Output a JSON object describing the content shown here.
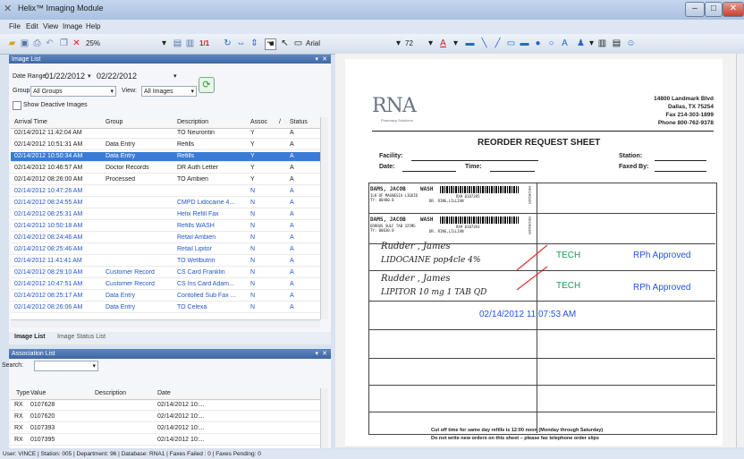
{
  "window": {
    "title": "Helix™ Imaging Module"
  },
  "menu": [
    "File",
    "Edit",
    "View",
    "Image",
    "Help"
  ],
  "toolbar": {
    "zoom": "25%",
    "pages": "1/1",
    "font": "Arial",
    "font_size": "72"
  },
  "image_list": {
    "title": "Image List",
    "date_range_label": "Date Range:",
    "date_from": "01/22/2012",
    "date_to": "02/22/2012",
    "group_label": "Group:",
    "group_value": "All Groups",
    "view_label": "View:",
    "view_value": "All Images",
    "show_deactive": "Show Deactive Images",
    "columns": [
      "Arrival Time",
      "Group",
      "Description",
      "Assoc",
      "Status"
    ],
    "rows": [
      {
        "time": "02/14/2012 11:42:04 AM",
        "group": "",
        "desc": "TO Neurontin",
        "assoc": "Y",
        "status": "A"
      },
      {
        "time": "02/14/2012 10:51:31 AM",
        "group": "Data Entry",
        "desc": "Refills",
        "assoc": "Y",
        "status": "A"
      },
      {
        "time": "02/14/2012 10:50:34 AM",
        "group": "Data Entry",
        "desc": "Refills",
        "assoc": "Y",
        "status": "A"
      },
      {
        "time": "02/14/2012 10:46:57 AM",
        "group": "Doctor Records",
        "desc": "DR Auth Letter",
        "assoc": "Y",
        "status": "A"
      },
      {
        "time": "02/14/2012 08:26:00 AM",
        "group": "Processed",
        "desc": "TO Ambien",
        "assoc": "Y",
        "status": "A"
      },
      {
        "time": "02/14/2012 10:47:26 AM",
        "group": "",
        "desc": "",
        "assoc": "N",
        "status": "A"
      },
      {
        "time": "02/14/2012 08:24:55 AM",
        "group": "",
        "desc": "CMPD Lidocaine 4...",
        "assoc": "N",
        "status": "A"
      },
      {
        "time": "02/14/2012 08:25:31 AM",
        "group": "",
        "desc": "Helix Refill Fax",
        "assoc": "N",
        "status": "A"
      },
      {
        "time": "02/14/2012 10:50:18 AM",
        "group": "",
        "desc": "Refills WASH",
        "assoc": "N",
        "status": "A"
      },
      {
        "time": "02/14/2012 08:24:46 AM",
        "group": "",
        "desc": "Retail Ambien",
        "assoc": "N",
        "status": "A"
      },
      {
        "time": "02/14/2012 08:25:46 AM",
        "group": "",
        "desc": "Retail Lipitor",
        "assoc": "N",
        "status": "A"
      },
      {
        "time": "02/14/2012 11:41:41 AM",
        "group": "",
        "desc": "TO Wellbutrin",
        "assoc": "N",
        "status": "A"
      },
      {
        "time": "02/14/2012 08:29:10 AM",
        "group": "Customer Record",
        "desc": "CS Card Franklin",
        "assoc": "N",
        "status": "A"
      },
      {
        "time": "02/14/2012 10:47:51 AM",
        "group": "Customer Record",
        "desc": "CS Ins Card Adam...",
        "assoc": "N",
        "status": "A"
      },
      {
        "time": "02/14/2012 08:25:17 AM",
        "group": "Data Entry",
        "desc": "Contolled Sub Fax ...",
        "assoc": "N",
        "status": "A"
      },
      {
        "time": "02/14/2012 08:26:06 AM",
        "group": "Data Entry",
        "desc": "TO Celexa",
        "assoc": "N",
        "status": "A"
      }
    ],
    "tabs": [
      "Image List",
      "Image Status List"
    ]
  },
  "association_list": {
    "title": "Association List",
    "search_label": "Search:",
    "columns": [
      "Type",
      "Value",
      "Description",
      "Date"
    ],
    "rows": [
      {
        "type": "RX",
        "value": "0107628",
        "desc": "",
        "date": "02/14/2012 10:..."
      },
      {
        "type": "RX",
        "value": "0107620",
        "desc": "",
        "date": "02/14/2012 10:..."
      },
      {
        "type": "RX",
        "value": "0107393",
        "desc": "",
        "date": "02/14/2012 10:..."
      },
      {
        "type": "RX",
        "value": "0107395",
        "desc": "",
        "date": "02/14/2012 10:..."
      }
    ]
  },
  "document": {
    "logo": "RNA",
    "logo_sub": "Pharmacy Solutions",
    "address": [
      "14800 Landmark Blvd",
      "Dallas, TX 75254",
      "Fax 214-303-1899",
      "Phone 800-762-9378"
    ],
    "title": "REORDER REQUEST SHEET",
    "facility_label": "Facility:",
    "date_label": "Date:",
    "time_label": "Time:",
    "station_label": "Station:",
    "faxed_label": "Faxed By:",
    "label1_name": "DAMS, JACOB",
    "label1_site": "WASH",
    "label1_drug": "ILK OF MAGNESIA LIQUID",
    "label1_rx": "RX# 0107395",
    "label1_qty": "TY: 00480.0",
    "label1_dr": "DR. RING,LILLIAN",
    "label2_name": "DAMS, JACOB",
    "label2_site": "WASH",
    "label2_drug": "ERROUS SULF TAB 325MG",
    "label2_rx": "RX# 0107393",
    "label2_qty": "TY: 00030.0",
    "label2_dr": "DR. RING,LILLIAN",
    "reorder": "REORDER",
    "hand1a": "Rudder , James",
    "hand1b": "LIDOCAINE  pop4cle  4%",
    "hand2a": "Rudder , James",
    "hand2b": "LIPITOR  10 mg  1 TAB QD",
    "tech": "TECH",
    "rph": "RPh Approved",
    "stamp": "02/14/2012 11:07:53 AM",
    "footer1": "Cut off time for same day refills is 12:00 noon (Monday through Saturday)",
    "footer2": "Do not write new orders on this sheet – please fax telephone order slips"
  },
  "status": "User: VINCE | Station: 005 | Department: 96 | Database: RNA1 | Faxes Failed : 0 | Faxes Pending: 0",
  "colors": {
    "accent": "#3a7bd5",
    "link": "#2356c7",
    "stamp": "#2255dd",
    "tech": "#1a9a5a"
  }
}
